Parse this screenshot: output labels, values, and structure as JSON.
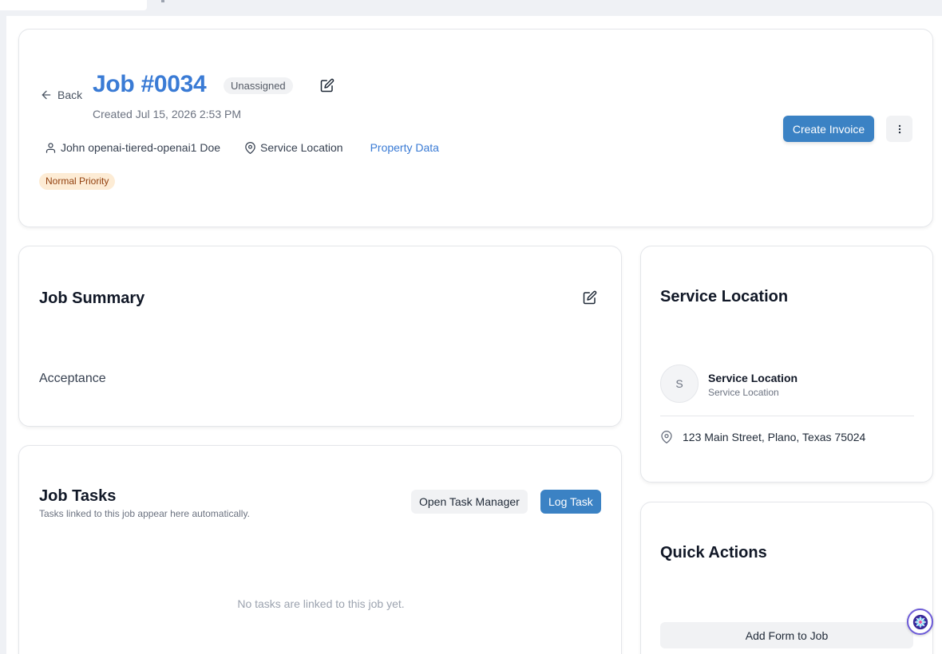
{
  "header": {
    "back_label": "Back",
    "job_title": "Job #0034",
    "status": "Unassigned",
    "created": "Created Jul 15, 2026 2:53 PM",
    "customer_name": "John openai-tiered-openai1 Doe",
    "location_label": "Service Location",
    "property_link": "Property Data",
    "priority": "Normal Priority",
    "create_invoice_label": "Create Invoice"
  },
  "summary": {
    "title": "Job Summary",
    "text": "Acceptance"
  },
  "tasks": {
    "title": "Job Tasks",
    "subtitle": "Tasks linked to this job appear here automatically.",
    "open_manager_label": "Open Task Manager",
    "log_task_label": "Log Task",
    "empty_text": "No tasks are linked to this job yet."
  },
  "location": {
    "title": "Service Location",
    "avatar_initial": "S",
    "name": "Service Location",
    "type": "Service Location",
    "address": "123 Main Street, Plano, Texas 75024"
  },
  "quick_actions": {
    "title": "Quick Actions",
    "add_form_label": "Add Form to Job"
  },
  "icons": {
    "back": "arrow-left-icon",
    "edit": "edit-icon",
    "user": "user-icon",
    "location": "map-pin-icon",
    "more": "more-vertical-icon",
    "assistant": "assistant-icon"
  },
  "colors": {
    "accent": "#3b82c4",
    "title_blue": "#3a7bd5",
    "priority_bg": "#fdecd5",
    "priority_text": "#92400e"
  }
}
